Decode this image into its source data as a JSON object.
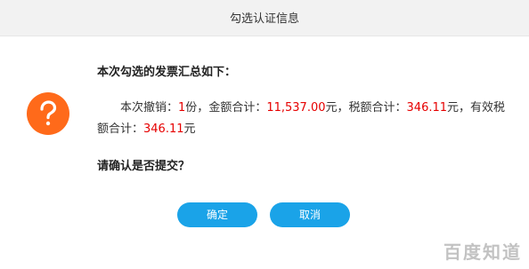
{
  "dialog": {
    "title": "勾选认证信息"
  },
  "icons": {
    "question": "question-mark-icon"
  },
  "message": {
    "heading": "本次勾选的发票汇总如下：",
    "prefix_cancel": "本次撤销：",
    "cancel_count": "1",
    "unit_fen": "份，",
    "amount_label": "金额合计：",
    "amount_value": "11,537.00",
    "yuan_comma_1": "元，",
    "tax_label": "税额合计：",
    "tax_value": "346.11",
    "yuan_comma_2": "元，",
    "effective_tax_label": "有效税额合计：",
    "effective_tax_value": "346.11",
    "yuan_end": "元"
  },
  "confirm_question": "请确认是否提交？",
  "buttons": {
    "ok": "确定",
    "cancel": "取消"
  },
  "watermark": "百度知道",
  "colors": {
    "accent_blue": "#1aa3e8",
    "icon_orange": "#ff6a1a",
    "value_red": "#e60000"
  }
}
